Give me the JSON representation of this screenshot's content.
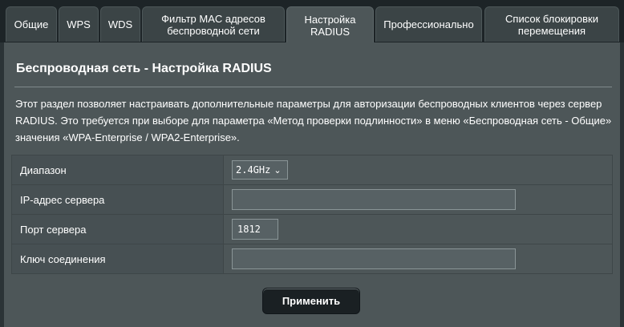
{
  "tabs": [
    {
      "label": "Общие"
    },
    {
      "label": "WPS"
    },
    {
      "label": "WDS"
    },
    {
      "label": "Фильтр MAC адресов беспроводной сети"
    },
    {
      "label": "Настройка RADIUS"
    },
    {
      "label": "Профессионально"
    },
    {
      "label": "Список блокировки перемещения"
    }
  ],
  "active_tab": "Настройка RADIUS",
  "page": {
    "title": "Беспроводная сеть - Настройка RADIUS",
    "description": "Этот раздел позволяет настраивать дополнительные параметры для авторизации беспроводных клиентов через сервер RADIUS. Это требуется при выборе для параметра «Метод проверки подлинности» в меню «Беспроводная сеть - Общие» значения «WPA-Enterprise / WPA2-Enterprise»."
  },
  "form": {
    "band_label": "Диапазон",
    "band_value": "2.4GHz",
    "server_ip_label": "IP-адрес сервера",
    "server_ip_value": "",
    "server_port_label": "Порт сервера",
    "server_port_value": "1812",
    "connection_key_label": "Ключ соединения",
    "connection_key_value": ""
  },
  "apply_label": "Применить",
  "colors": {
    "background": "#2b3336",
    "panel": "#4d5658",
    "button": "#1a2023"
  }
}
